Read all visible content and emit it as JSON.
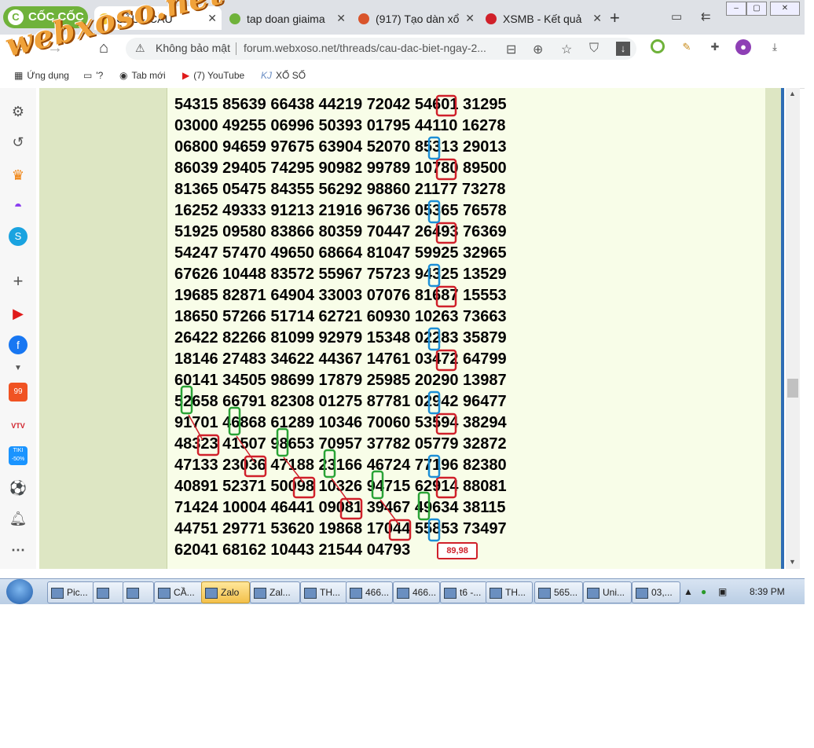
{
  "browser": {
    "brand_name": "CỐC CỐC",
    "brand_logo": "C",
    "tabs": [
      {
        "label": "CẦU - CẦU",
        "active": true,
        "favicon": "XS"
      },
      {
        "label": "tap doan giaima",
        "active": false
      },
      {
        "label": "(917) Tạo dàn xổ",
        "active": false
      },
      {
        "label": "XSMB - Kết quả",
        "active": false
      }
    ],
    "address": {
      "security_label": "Không bảo mật",
      "url": "forum.webxoso.net/threads/cau-dac-biet-ngay-2..."
    },
    "bookmarks": [
      {
        "label": "Ứng dụng",
        "icon": "apps-grid-icon"
      },
      {
        "label": "'?",
        "icon": "folder-icon"
      },
      {
        "label": "Tab mới",
        "icon": "globe-icon"
      },
      {
        "label": "(7) YouTube",
        "icon": "youtube-icon"
      },
      {
        "label": "XỔ SỐ",
        "icon": "xoso-logo-icon"
      }
    ]
  },
  "watermark": "webxoso.net",
  "sidebar_icons": [
    "settings-icon",
    "history-icon",
    "crown-icon",
    "messenger-icon",
    "skype-icon",
    "add-icon",
    "youtube-icon",
    "facebook-icon",
    "chevron-down-icon",
    "shopee-icon",
    "vtv-icon",
    "tiki-icon",
    "football-icon",
    "bell-icon",
    "more-icon"
  ],
  "sidebar_badges": {
    "shopee": "99",
    "vtv": "VTV",
    "tiki": "TIKI -50%"
  },
  "post": {
    "rows": [
      "54315 85639 66438 44219 72042 54601 31295",
      "03000 49255 06996 50393 01795 44110 16278",
      "06800 94659 97675 63904 52070 85313 29013",
      "86039 29405 74295 90982 99789 10780 89500",
      "81365 05475 84355 56292 98860 21177 73278",
      "16252 49333 91213 21916 96736 05365 76578",
      "51925 09580 83866 80359 70447 26493 76369",
      "54247 57470 49650 68664 81047 59925 32965",
      "67626 10448 83572 55967 75723 94325 13529",
      "19685 82871 64904 33003 07076 81687 15553",
      "18650 57266 51714 62721 60930 10263 73663",
      "26422 82266 81099 92979 15348 02283 35879",
      "18146 27483 34622 44367 14761 03472 64799",
      "60141 34505 98699 17879 25985 20290 13987",
      "52658 66791 82308 01275 87781 02942 96477",
      "91701 46868 61289 10346 70060 53594 38294",
      "48323 41507 98653 70957 37782 05779 32872",
      "47133 23036 47188 23166 46724 77196 82380",
      "40891 52371 50098 10326 94715 62914 88081",
      "71424 10004 46441 09081 39467 49634 38115",
      "44751 29771 53620 19868 17044 55853 73497",
      "62041 68162 10443 21544 04793"
    ],
    "result_label": "89,98"
  },
  "taskbar": {
    "items": [
      "Pic...",
      "",
      "",
      "CẦ...",
      "Zalo",
      "Zal...",
      "TH...",
      "466...",
      "466...",
      "t6 -...",
      "TH...",
      "565...",
      "Uni...",
      "03,..."
    ],
    "clock": "8:39 PM"
  },
  "colors": {
    "post_bg": "#f8fde8",
    "side_bg": "#dde6c3",
    "highlight_red": "#d0202a",
    "highlight_blue": "#1d8fd6",
    "highlight_green": "#2aa336"
  }
}
